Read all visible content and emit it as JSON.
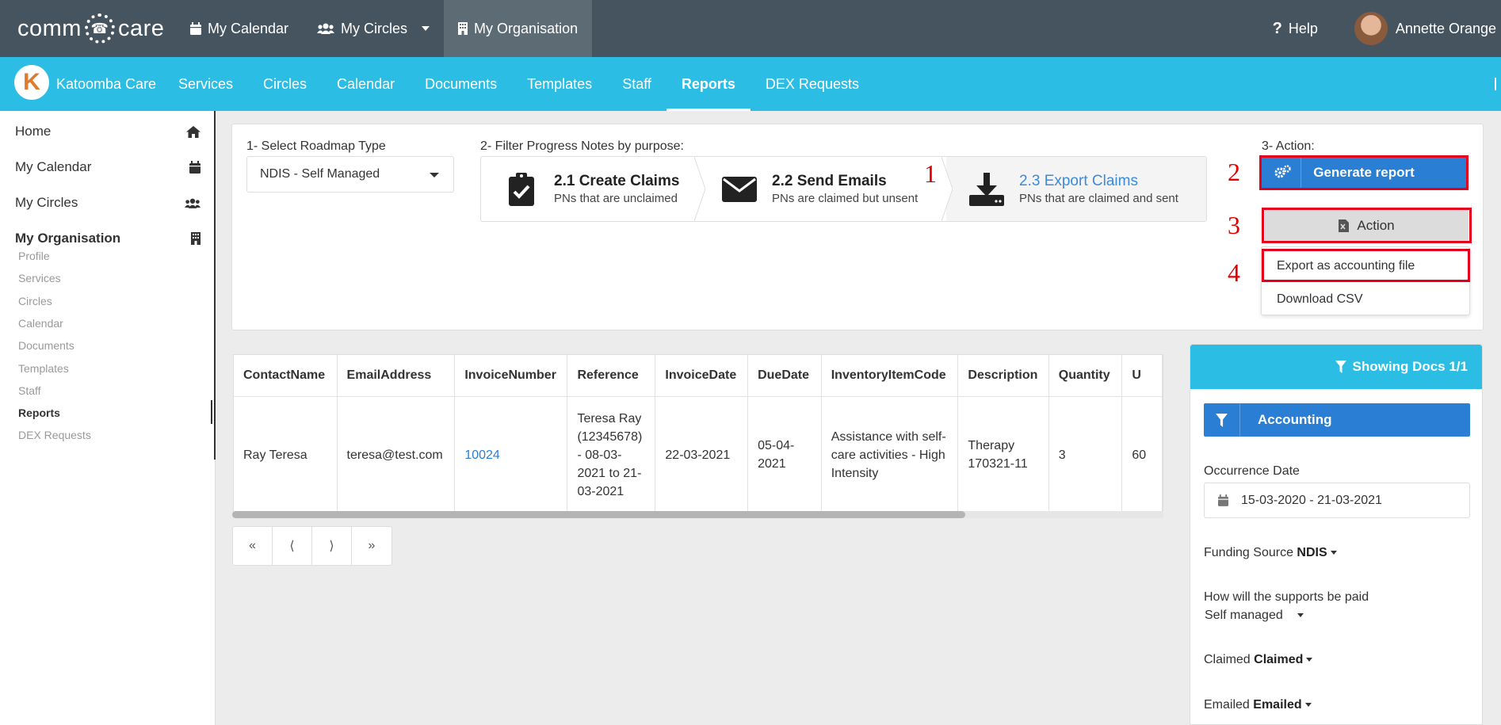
{
  "app": {
    "logo_left": "comm",
    "logo_right": "care"
  },
  "topnav": {
    "items": [
      {
        "label": "My Calendar",
        "icon": "calendar-icon"
      },
      {
        "label": "My Circles",
        "icon": "users-icon"
      },
      {
        "label": "My Organisation",
        "icon": "building-icon",
        "active": true
      }
    ],
    "help": "Help",
    "user": "Annette Orange"
  },
  "subnav": {
    "org_initial": "K",
    "org_name": "Katoomba Care",
    "items": [
      "Services",
      "Circles",
      "Calendar",
      "Documents",
      "Templates",
      "Staff",
      "Reports",
      "DEX Requests"
    ],
    "active": "Reports"
  },
  "sidebar": {
    "main": [
      {
        "label": "Home",
        "icon": "home-icon"
      },
      {
        "label": "My Calendar",
        "icon": "calendar-icon"
      },
      {
        "label": "My Circles",
        "icon": "users-icon"
      },
      {
        "label": "My Organisation",
        "icon": "building-icon"
      }
    ],
    "sub": [
      "Profile",
      "Services",
      "Circles",
      "Calendar",
      "Documents",
      "Templates",
      "Staff",
      "Reports",
      "DEX Requests"
    ],
    "active_sub": "Reports"
  },
  "roadmap": {
    "label": "1- Select Roadmap Type",
    "value": "NDIS - Self Managed"
  },
  "filter": {
    "label": "2- Filter Progress Notes by purpose:",
    "steps": [
      {
        "title": "2.1 Create Claims",
        "sub": "PNs that are unclaimed",
        "icon": "clipboard-check-icon"
      },
      {
        "title": "2.2 Send Emails",
        "sub": "PNs are claimed but unsent",
        "icon": "envelope-icon"
      },
      {
        "title": "2.3 Export Claims",
        "sub": "PNs that are claimed and sent",
        "icon": "download-icon",
        "active": true
      }
    ]
  },
  "action": {
    "label": "3- Action:",
    "generate": "Generate report",
    "action": "Action",
    "menu": [
      "Export as accounting file",
      "Download CSV"
    ]
  },
  "annotations": [
    "1",
    "2",
    "3",
    "4"
  ],
  "table": {
    "columns": [
      "ContactName",
      "EmailAddress",
      "InvoiceNumber",
      "Reference",
      "InvoiceDate",
      "DueDate",
      "InventoryItemCode",
      "Description",
      "Quantity",
      "U"
    ],
    "rows": [
      [
        "Ray Teresa",
        "teresa@test.com",
        "10024",
        "Teresa Ray (12345678) - 08-03-2021 to 21-03-2021",
        "22-03-2021",
        "05-04-2021",
        "Assistance with self-care activities - High Intensity",
        "Therapy 170321-11",
        "3",
        "60"
      ]
    ],
    "pager": [
      "«",
      "⟨",
      "⟩",
      "»"
    ]
  },
  "filters_panel": {
    "header": "Showing Docs 1/1",
    "button": "Accounting",
    "occurrence_label": "Occurrence Date",
    "occurrence_value": "15-03-2020 - 21-03-2021",
    "funding_label": "Funding Source",
    "funding_value": "NDIS",
    "paid_label": "How will the supports be paid",
    "paid_value": "Self managed",
    "claimed_label": "Claimed",
    "claimed_value": "Claimed",
    "emailed_label": "Emailed",
    "emailed_value": "Emailed"
  },
  "colors": {
    "topbar": "#45545f",
    "subbar": "#2bbde4",
    "primary": "#2a7fd4",
    "annotation": "#e3001b"
  }
}
